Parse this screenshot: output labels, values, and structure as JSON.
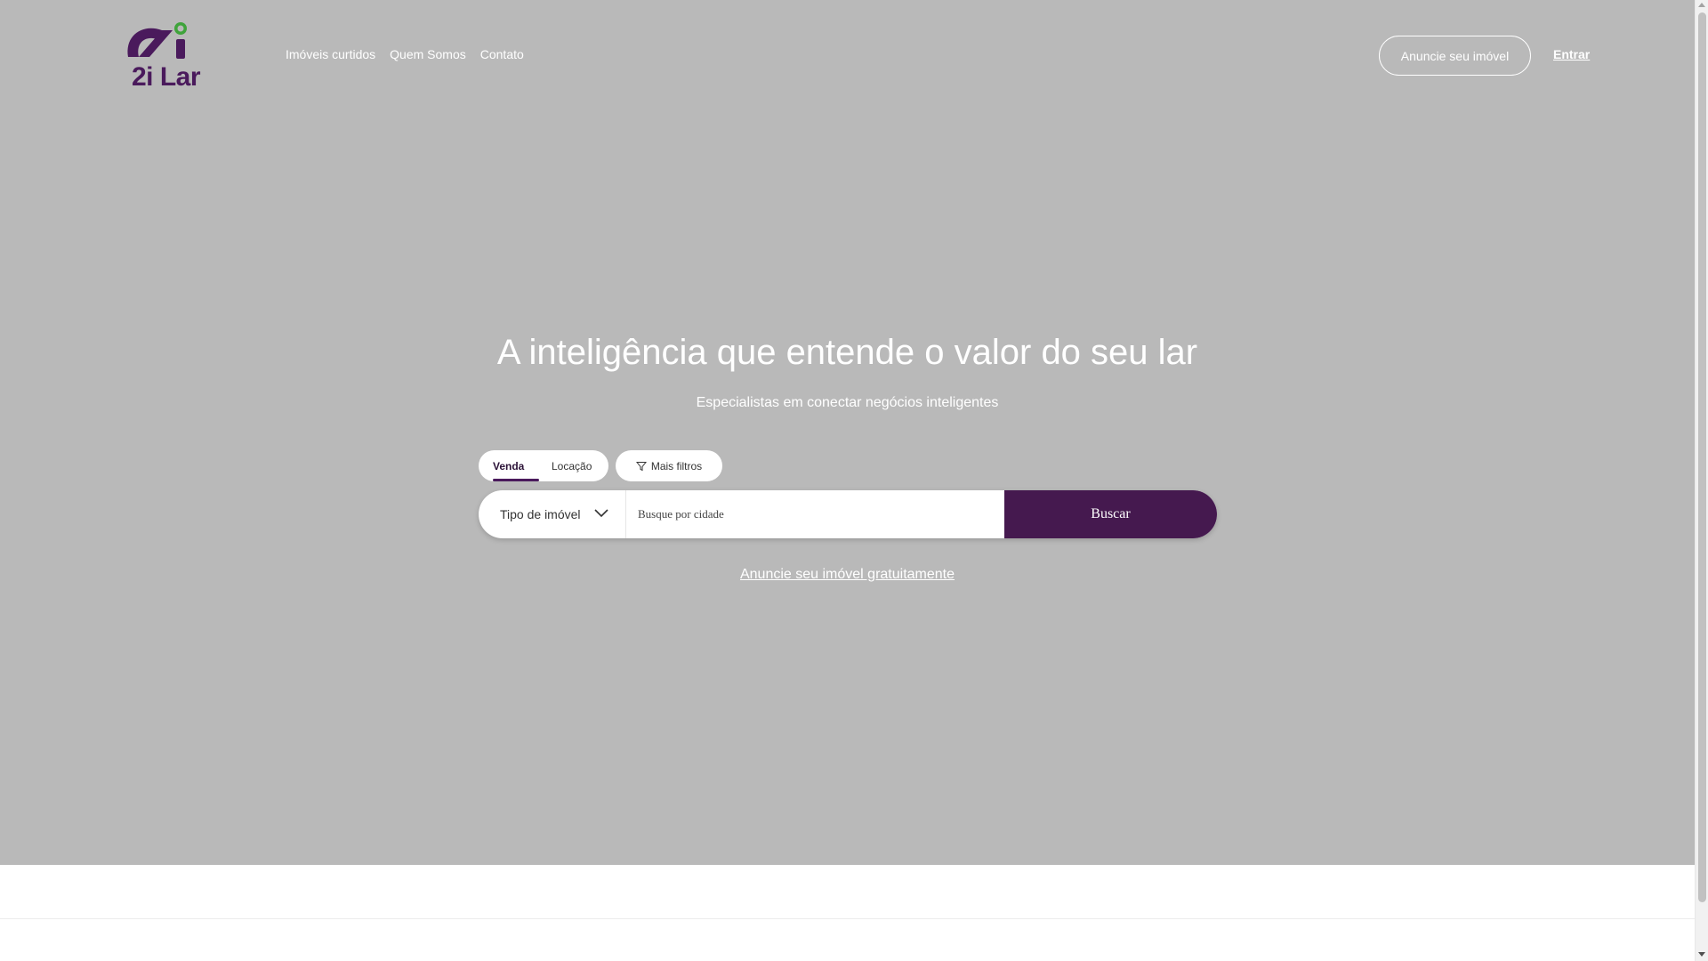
{
  "brand": {
    "logo_text": "2i Lar",
    "primary_color": "#4a1a5c",
    "accent_color": "#3fa33b"
  },
  "header": {
    "nav": [
      "Imóveis curtidos",
      "Quem Somos",
      "Contato"
    ],
    "anuncie_label": "Anuncie seu imóvel",
    "entrar_label": "Entrar"
  },
  "hero": {
    "headline": "A inteligência que entende o valor do seu lar",
    "subline": "Especialistas em conectar negócios inteligentes",
    "background_color": "#b9b9b9"
  },
  "search": {
    "modes": [
      "Venda",
      "Locação"
    ],
    "active_mode": "Venda",
    "more_filters_label": "Mais filtros",
    "type_select_label": "Tipo de imóvel",
    "city_placeholder": "Busque por cidade",
    "button_label": "Buscar"
  },
  "free_listing_link": "Anuncie seu imóvel gratuitamente"
}
